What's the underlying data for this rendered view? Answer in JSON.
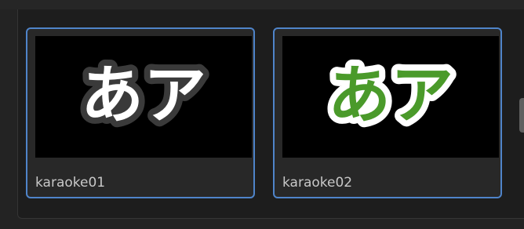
{
  "thumbnails": [
    {
      "name": "karaoke01",
      "preview_text": "あア",
      "fill_color": "#ffffff",
      "stroke_color": "#3a3a3a"
    },
    {
      "name": "karaoke02",
      "preview_text": "あア",
      "fill_color": "#4a9a2a",
      "stroke_color": "#ffffff"
    }
  ],
  "colors": {
    "selection_border": "#4f84c9",
    "panel_background": "#1d1d1d",
    "card_background": "#282828",
    "label_text": "#c8c8c8"
  }
}
